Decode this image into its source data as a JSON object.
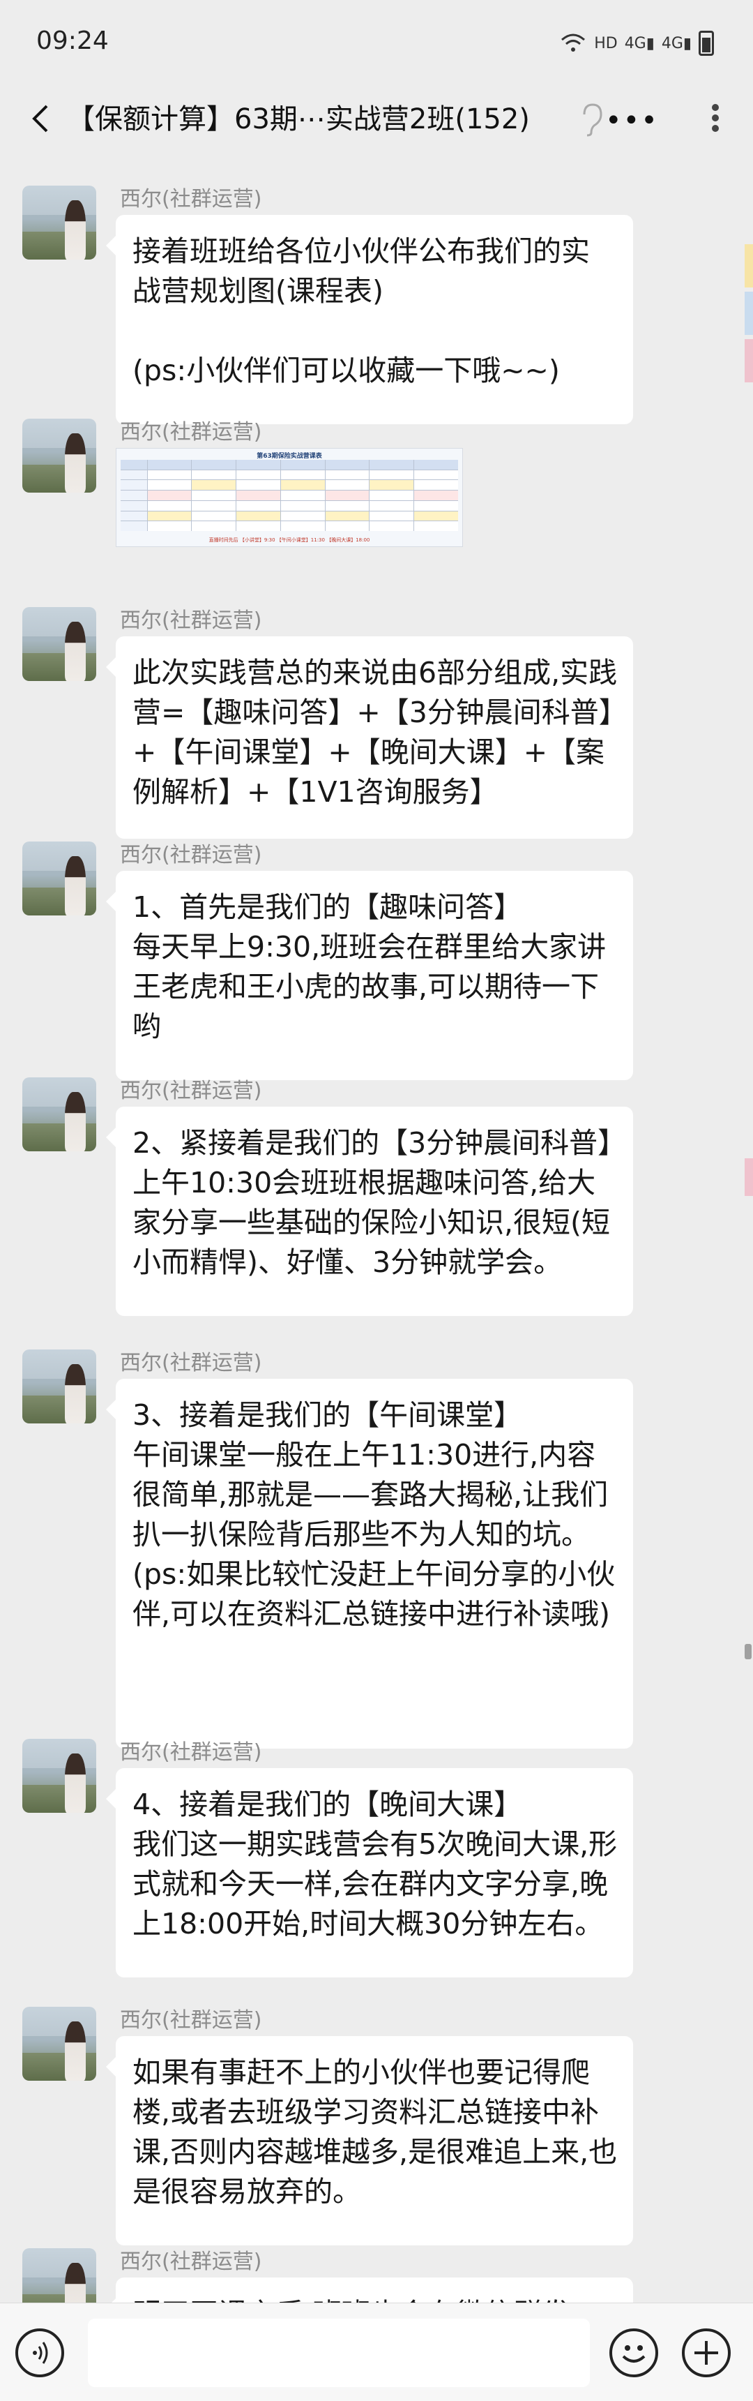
{
  "status_bar": {
    "time": "09:24",
    "network_label": "HD",
    "signal_1": "4G",
    "signal_2": "4G"
  },
  "header": {
    "title": "【保额计算】63期⋯实战营2班(152)",
    "more_label": "•••"
  },
  "colors": {
    "background": "#ededed",
    "bubble": "#ffffff",
    "sender_name": "#8c8c8c",
    "side_yellow": "#f7e4a6",
    "side_blue": "#c9dcef",
    "side_pink": "#f0c2cd"
  },
  "messages": [
    {
      "sender": "西尔(社群运营)",
      "type": "text",
      "text": "接着班班给各位小伙伴公布我们的实战营规划图(课程表)\n\n(ps:小伙伴们可以收藏一下哦~~)"
    },
    {
      "sender": "西尔(社群运营)",
      "type": "image",
      "image_title": "第63期保险实战营课表",
      "image_footer": "直播时间先后 【小讲堂】9:30 【午间小课堂】11:30 【晚间大课】18:00"
    },
    {
      "sender": "西尔(社群运营)",
      "type": "text",
      "text": "此次实践营总的来说由6部分组成,实践营=【趣味问答】+【3分钟晨间科普】+【午间课堂】+【晚间大课】+【案例解析】+【1V1咨询服务】"
    },
    {
      "sender": "西尔(社群运营)",
      "type": "text",
      "text": "1、首先是我们的【趣味问答】\n每天早上9:30,班班会在群里给大家讲王老虎和王小虎的故事,可以期待一下哟"
    },
    {
      "sender": "西尔(社群运营)",
      "type": "text",
      "text": "2、紧接着是我们的【3分钟晨间科普】上午10:30会班班根据趣味问答,给大家分享一些基础的保险小知识,很短(短小而精悍)、好懂、3分钟就学会。"
    },
    {
      "sender": "西尔(社群运营)",
      "type": "text",
      "text": "3、接着是我们的【午间课堂】\n午间课堂一般在上午11:30进行,内容很简单,那就是——套路大揭秘,让我们扒一扒保险背后那些不为人知的坑。\n(ps:如果比较忙没赶上午间分享的小伙伴,可以在资料汇总链接中进行补读哦)"
    },
    {
      "sender": "西尔(社群运营)",
      "type": "text",
      "text": "4、接着是我们的【晚间大课】\n我们这一期实践营会有5次晚间大课,形式就和今天一样,会在群内文字分享,晚上18:00开始,时间大概30分钟左右。"
    },
    {
      "sender": "西尔(社群运营)",
      "type": "text",
      "text": "如果有事赶不上的小伙伴也要记得爬楼,或者去班级学习资料汇总链接中补课,否则内容越堆越多,是很难追上来,也是很容易放弃的。"
    },
    {
      "sender": "西尔(社群运营)",
      "type": "text",
      "text": "明天开课之后,班班也会在微信群发"
    }
  ],
  "input_bar": {
    "placeholder": "",
    "icons": [
      "voice-icon",
      "emoji-icon",
      "plus-icon"
    ]
  }
}
